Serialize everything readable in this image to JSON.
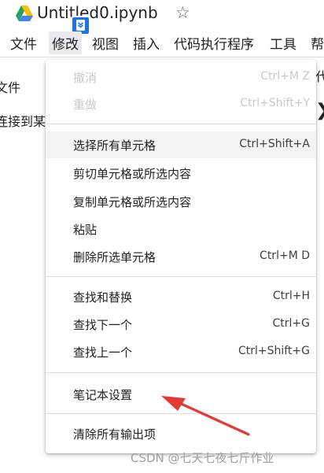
{
  "titlebar": {
    "drive_icon": "google-drive-logo",
    "title": "Untitled0.ipynb",
    "star_icon": "star-outline",
    "extension_icon": "bookmark-extension"
  },
  "menubar": {
    "items": [
      {
        "label": "文件"
      },
      {
        "label": "修改"
      },
      {
        "label": "视图"
      },
      {
        "label": "插入"
      },
      {
        "label": "代码执行程序"
      },
      {
        "label": "工具"
      },
      {
        "label": "帮"
      }
    ],
    "active_index": 1
  },
  "background": {
    "text_file": "文件",
    "text_connect": "连接到某",
    "text_right": "代",
    "chevron_icon": "chevron-right"
  },
  "dropdown": {
    "items": [
      {
        "label": "撤消",
        "shortcut": "Ctrl+M Z",
        "disabled": true
      },
      {
        "label": "重做",
        "shortcut": "Ctrl+Shift+Y",
        "disabled": true
      },
      {
        "label": "选择所有单元格",
        "shortcut": "Ctrl+Shift+A",
        "highlighted": true
      },
      {
        "label": "剪切单元格或所选内容",
        "shortcut": ""
      },
      {
        "label": "复制单元格或所选内容",
        "shortcut": ""
      },
      {
        "label": "粘贴",
        "shortcut": ""
      },
      {
        "label": "删除所选单元格",
        "shortcut": "Ctrl+M D"
      },
      {
        "label": "查找和替换",
        "shortcut": "Ctrl+H"
      },
      {
        "label": "查找下一个",
        "shortcut": "Ctrl+G"
      },
      {
        "label": "查找上一个",
        "shortcut": "Ctrl+Shift+G"
      },
      {
        "label": "笔记本设置",
        "shortcut": ""
      },
      {
        "label": "清除所有输出项",
        "shortcut": ""
      }
    ]
  },
  "watermark": "CSDN @七天七夜七斤作业",
  "colors": {
    "annotation_arrow": "#e53935",
    "highlight": "#f1f3f4",
    "disabled_text": "#c8cacd"
  }
}
